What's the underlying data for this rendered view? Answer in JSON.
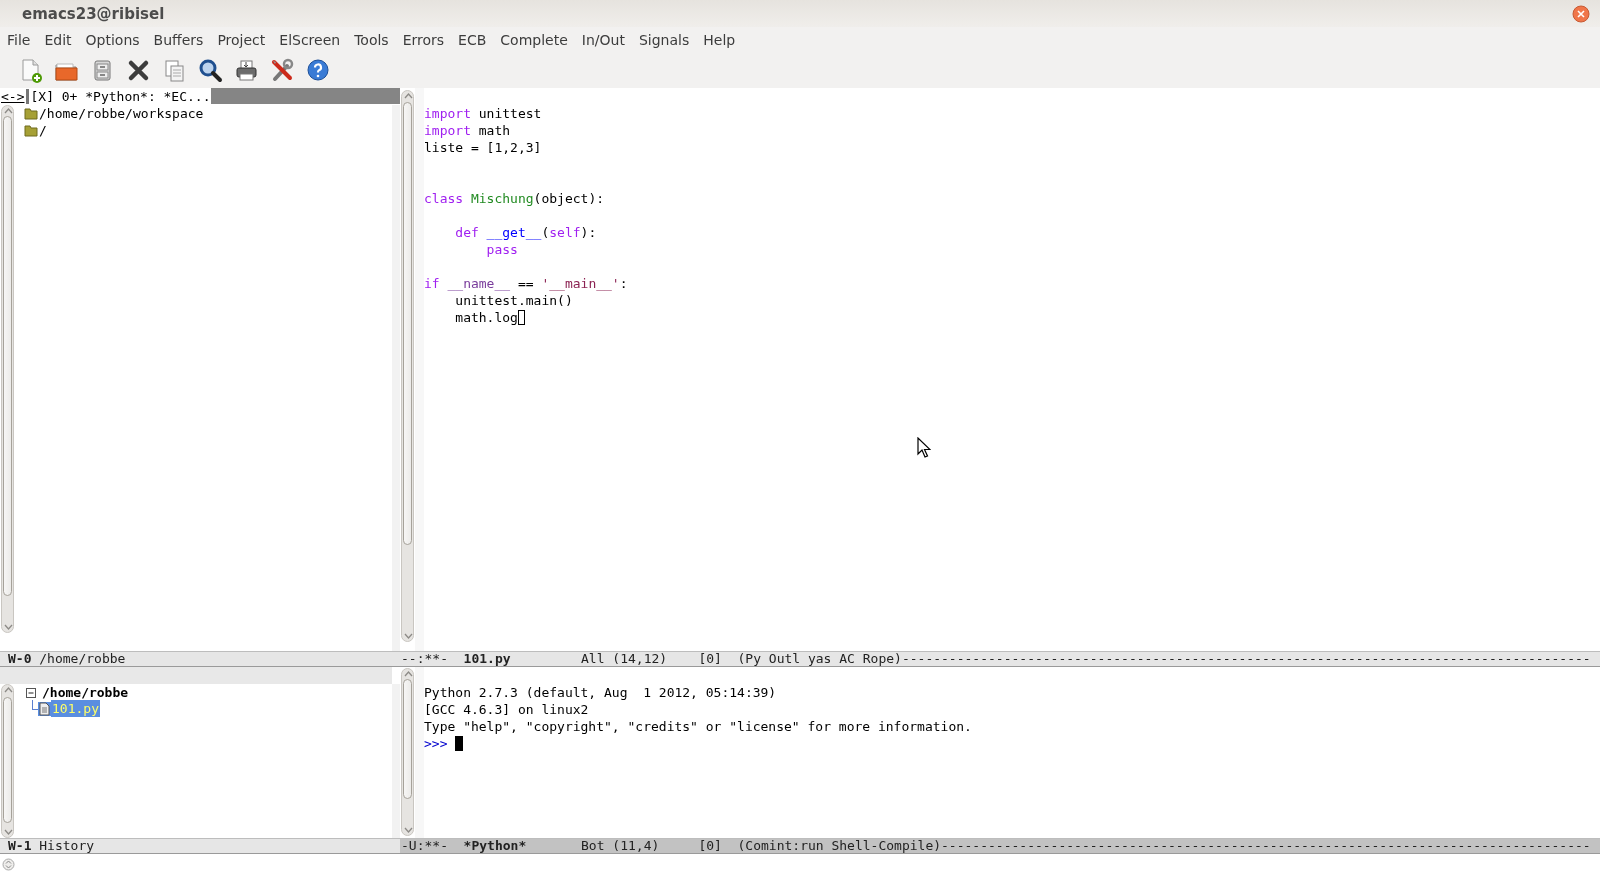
{
  "window": {
    "title": "emacs23@ribisel"
  },
  "menu": [
    "File",
    "Edit",
    "Options",
    "Buffers",
    "Project",
    "ElScreen",
    "Tools",
    "Errors",
    "ECB",
    "Complete",
    "In/Out",
    "Signals",
    "Help"
  ],
  "ecb_header": {
    "toggle": "<->",
    "buffers": "[X] 0+ *Python*: *EC..."
  },
  "directories": [
    {
      "label": "/home/robbe/workspace",
      "selected": false
    },
    {
      "label": "/",
      "selected": false
    }
  ],
  "directories_mode_line": {
    "window": "W-0",
    "name": "/home/robbe",
    "active": false
  },
  "editor": {
    "lines": [
      {
        "kind": "blank"
      },
      {
        "kind": "code",
        "tokens": [
          {
            "text": "import",
            "kind": "keyword"
          },
          {
            "text": " unittest",
            "kind": "plain"
          }
        ]
      },
      {
        "kind": "code",
        "tokens": [
          {
            "text": "import",
            "kind": "keyword"
          },
          {
            "text": " math",
            "kind": "plain"
          }
        ]
      },
      {
        "kind": "code",
        "tokens": [
          {
            "text": "liste = [1,2,3]",
            "kind": "plain"
          }
        ]
      },
      {
        "kind": "blank"
      },
      {
        "kind": "blank"
      },
      {
        "kind": "code",
        "tokens": [
          {
            "text": "class",
            "kind": "keyword"
          },
          {
            "text": " Mischung",
            "kind": "type"
          },
          {
            "text": "(object):",
            "kind": "plain"
          }
        ]
      },
      {
        "kind": "blank"
      },
      {
        "kind": "code",
        "tokens": [
          {
            "text": "    def",
            "kind": "keyword"
          },
          {
            "text": " __get__",
            "kind": "function"
          },
          {
            "text": "(",
            "kind": "plain"
          },
          {
            "text": "self",
            "kind": "keyword"
          },
          {
            "text": "):",
            "kind": "plain"
          }
        ]
      },
      {
        "kind": "code",
        "tokens": [
          {
            "text": "        pass",
            "kind": "keyword"
          }
        ]
      },
      {
        "kind": "blank"
      },
      {
        "kind": "code",
        "tokens": [
          {
            "text": "if",
            "kind": "keyword"
          },
          {
            "text": " __name__",
            "kind": "builtin"
          },
          {
            "text": " == ",
            "kind": "plain"
          },
          {
            "text": "'__main__'",
            "kind": "string"
          },
          {
            "text": ":",
            "kind": "plain"
          }
        ]
      },
      {
        "kind": "code",
        "tokens": [
          {
            "text": "    unittest.main()",
            "kind": "plain"
          }
        ]
      },
      {
        "kind": "code",
        "tokens": [
          {
            "text": "    math.log",
            "kind": "plain"
          }
        ]
      }
    ]
  },
  "editor_mode_line": {
    "active": false,
    "segments": [
      {
        "text": "--:**-",
        "bold": false
      },
      {
        "text": "101.py",
        "bold": true
      },
      {
        "text": "All (14,12)",
        "bold": false
      },
      {
        "text": "[0]",
        "bold": false
      },
      {
        "text": "(Py Outl yas AC Rope)",
        "bold": false
      },
      {
        "text": "----------------------------------------------------------------------------------------",
        "bold": false
      }
    ]
  },
  "history": [
    {
      "label": "/home/robbe",
      "expanded": true,
      "selected": false,
      "children": [
        {
          "label": "101.py",
          "selected": true
        }
      ]
    }
  ],
  "history_mode_line": {
    "window": "W-1",
    "name": "History",
    "active": false
  },
  "shell": {
    "prompt": ">>>",
    "lines": [
      {
        "kind": "blank"
      },
      {
        "kind": "output",
        "text": "Python 2.7.3 (default, Aug  1 2012, 05:14:39)"
      },
      {
        "kind": "output",
        "text": "[GCC 4.6.3] on linux2"
      },
      {
        "kind": "output",
        "text": "Type \"help\", \"copyright\", \"credits\" or \"license\" for more information."
      }
    ]
  },
  "shell_mode_line": {
    "active": true,
    "segments": [
      {
        "text": "-U:**-",
        "bold": false
      },
      {
        "text": "*Python*",
        "bold": true
      },
      {
        "text": "Bot (11,4)",
        "bold": false
      },
      {
        "text": "[0]",
        "bold": false
      },
      {
        "text": "(Comint:run Shell-Compile)",
        "bold": false
      },
      {
        "text": "-----------------------------------------------------------------------------------",
        "bold": false
      }
    ]
  }
}
